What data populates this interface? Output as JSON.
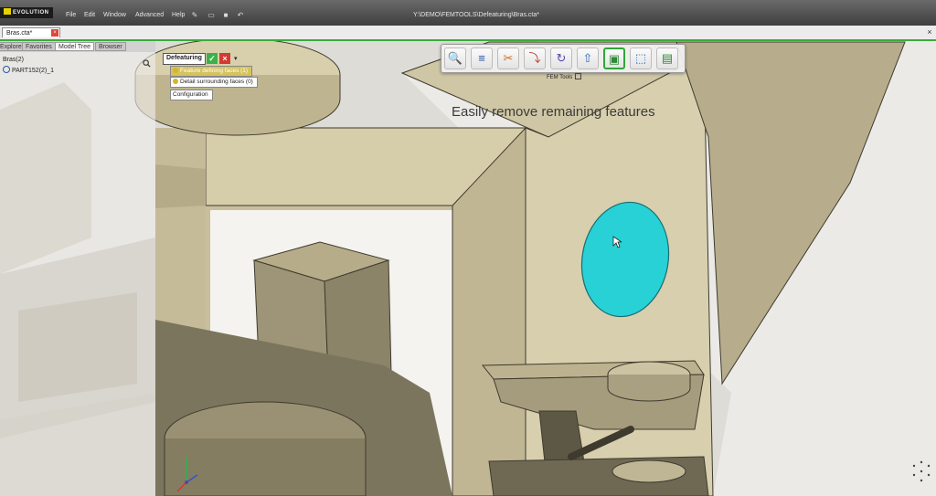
{
  "app": {
    "logo_text": "EVOLUTION",
    "window_title": "Y:\\DEMO\\FEMTOOLS\\Defeaturing\\Bras.cta*"
  },
  "menu": [
    "File",
    "Edit",
    "Window",
    "Advanced",
    "Help"
  ],
  "document_tab": {
    "label": "Bras.cta*"
  },
  "panel": {
    "tabs": [
      "Explorer",
      "Favorites",
      "Model Tree",
      "Browser"
    ],
    "active_tab": "Model Tree",
    "tree": {
      "root": "Bras(2)",
      "child": "PART152(2)_1"
    }
  },
  "defeaturing": {
    "title": "Defeaturing",
    "options": [
      "Feature defining faces (1)",
      "Detail surrounding faces (0)",
      "Configuration"
    ]
  },
  "fem_toolbar": {
    "label": "FEM Tools",
    "buttons": [
      "search-tool-icon",
      "edit-tool-icon",
      "scissors-tool-icon",
      "crop-tool-icon",
      "rotate-tool-icon",
      "export-up-icon",
      "select-face-icon",
      "box-select-icon",
      "mesh-tool-icon"
    ],
    "active_button": "select-face-icon"
  },
  "caption": "Easily remove remaining features",
  "colors": {
    "highlight": "#27d1d6",
    "tan_light": "#dcd3b4",
    "tan_mid": "#c7bd9b",
    "tan_dark": "#7d765f",
    "accent": "#3aaa3a"
  }
}
